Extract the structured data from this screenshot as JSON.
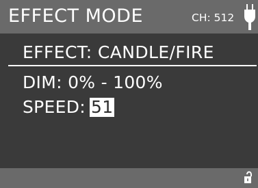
{
  "header": {
    "title": "EFFECT MODE",
    "channel": "CH: 512",
    "status_icon": "plug-icon"
  },
  "content": {
    "effect_label": "EFFECT: CANDLE/FIRE",
    "dim_label": "DIM: 0% - 100%",
    "speed_label": "SPEED:",
    "speed_value": "51"
  },
  "footer": {
    "lock_icon": "unlocked-lock-icon"
  },
  "colors": {
    "background": "#3a3a3a",
    "header_footer": "#6a6a6a",
    "text": "#ffffff",
    "selected_value_bg": "#ffffff",
    "selected_value_text": "#2f2f2f"
  }
}
